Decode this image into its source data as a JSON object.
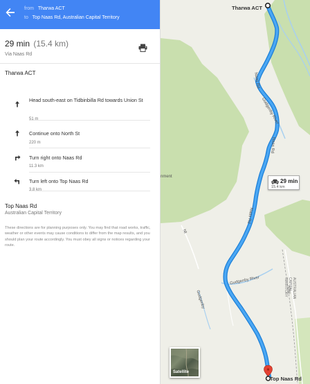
{
  "header": {
    "from_label": "from",
    "from_value": "Tharwa ACT",
    "to_label": "to",
    "to_value": "Top Naas Rd, Australian Capital Territory",
    "back_icon": "arrow-left-icon"
  },
  "summary": {
    "time": "29 min",
    "distance": "(15.4 km)",
    "via": "Via Naas Rd",
    "print_icon": "printer-icon"
  },
  "origin": "Tharwa ACT",
  "steps": [
    {
      "icon": "arrow-up-icon",
      "text": "Head south-east on Tidbinbilla Rd towards Union St",
      "distance": "51 m"
    },
    {
      "icon": "arrow-up-icon",
      "text": "Continue onto North St",
      "distance": "220 m"
    },
    {
      "icon": "turn-right-icon",
      "text": "Turn right onto Naas Rd",
      "distance": "11.3 km"
    },
    {
      "icon": "turn-left-icon",
      "text": "Turn left onto Top Naas Rd",
      "distance": "3.8 km"
    }
  ],
  "destination": {
    "name": "Top Naas Rd",
    "region": "Australian Capital Territory"
  },
  "disclaimer": "These directions are for planning purposes only. You may find that road works, traffic, weather or other events may cause conditions to differ from the map results, and you should plan your route accordingly. You must obey all signs or notices regarding your route.",
  "map": {
    "origin_label": "Tharwa ACT",
    "destination_label": "Top Naas Rd",
    "duration_box": {
      "time": "29 min",
      "distance": "15.4 km"
    },
    "satellite_label": "Satellite",
    "fragments": {
      "gudgenby_river": "Gudgenby River",
      "gudgenby_river_2": "Gudgenby River",
      "naas_rd": "Naas Rd",
      "naas_rd_2": "Naas Rd",
      "naas_rd_3": "Naas Rd",
      "nment": "nment",
      "territory": "AUSTRALIAN CAPITAL TERRITORY",
      "nsw": "NSW",
      "gudgenby": "Gudgenby",
      "nt": "Nt"
    },
    "colors": {
      "route": "#4aa7f4",
      "route_outline": "#1d7fd6",
      "park": "#c9dfae",
      "land": "#efefe8",
      "river": "#a8d0f0",
      "header": "#4285f4",
      "marker": "#e34133"
    }
  }
}
